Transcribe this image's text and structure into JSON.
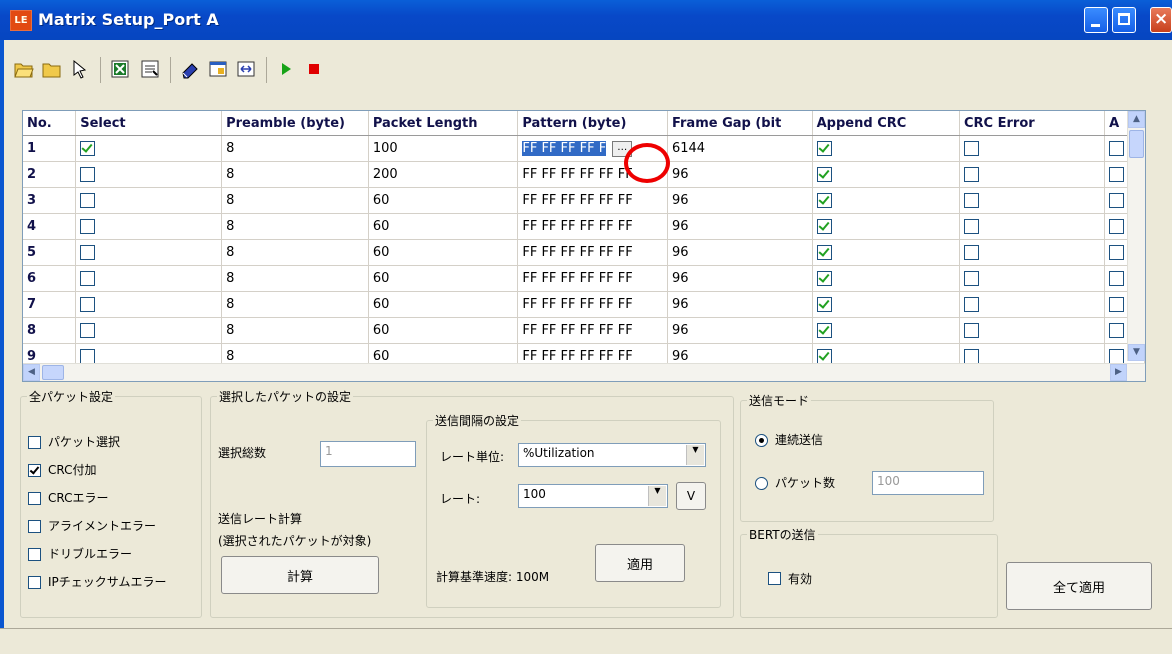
{
  "window": {
    "title": "Matrix Setup_Port A",
    "app_icon": "LE"
  },
  "toolbar": {
    "icons": [
      "open-folder-icon",
      "folder-icon",
      "pointer-icon",
      "excel-icon",
      "export-icon",
      "eraser-icon",
      "window-icon",
      "fit-width-icon",
      "play-icon",
      "stop-icon"
    ],
    "colors": {
      "play": "#17a317",
      "stop": "#e00000"
    }
  },
  "grid": {
    "columns": [
      "No.",
      "Select",
      "Preamble (byte)",
      "Packet Length",
      "Pattern (byte)",
      "Frame Gap (bit",
      "Append CRC",
      "CRC Error",
      "A"
    ],
    "rows": [
      {
        "no": "1",
        "select": true,
        "preamble": "8",
        "length": "100",
        "pattern": "FF FF FF FF F",
        "gap": "6144",
        "crc": true,
        "crc_error": false
      },
      {
        "no": "2",
        "select": false,
        "preamble": "8",
        "length": "200",
        "pattern": "FF FF FF FF FF FF",
        "gap": "96",
        "crc": true,
        "crc_error": false
      },
      {
        "no": "3",
        "select": false,
        "preamble": "8",
        "length": "60",
        "pattern": "FF FF FF FF FF FF",
        "gap": "96",
        "crc": true,
        "crc_error": false
      },
      {
        "no": "4",
        "select": false,
        "preamble": "8",
        "length": "60",
        "pattern": "FF FF FF FF FF FF",
        "gap": "96",
        "crc": true,
        "crc_error": false
      },
      {
        "no": "5",
        "select": false,
        "preamble": "8",
        "length": "60",
        "pattern": "FF FF FF FF FF FF",
        "gap": "96",
        "crc": true,
        "crc_error": false
      },
      {
        "no": "6",
        "select": false,
        "preamble": "8",
        "length": "60",
        "pattern": "FF FF FF FF FF FF",
        "gap": "96",
        "crc": true,
        "crc_error": false
      },
      {
        "no": "7",
        "select": false,
        "preamble": "8",
        "length": "60",
        "pattern": "FF FF FF FF FF FF",
        "gap": "96",
        "crc": true,
        "crc_error": false
      },
      {
        "no": "8",
        "select": false,
        "preamble": "8",
        "length": "60",
        "pattern": "FF FF FF FF FF FF",
        "gap": "96",
        "crc": true,
        "crc_error": false
      },
      {
        "no": "9",
        "select": false,
        "preamble": "8",
        "length": "60",
        "pattern": "FF FF FF FF FF FF",
        "gap": "96",
        "crc": true,
        "crc_error": false
      }
    ]
  },
  "all_packet": {
    "legend": "全パケット設定",
    "options": [
      {
        "label": "パケット選択",
        "checked": false
      },
      {
        "label": "CRC付加",
        "checked": true
      },
      {
        "label": "CRCエラー",
        "checked": false
      },
      {
        "label": "アライメントエラー",
        "checked": false
      },
      {
        "label": "ドリブルエラー",
        "checked": false
      },
      {
        "label": "IPチェックサムエラー",
        "checked": false
      }
    ]
  },
  "selected_packet": {
    "legend": "選択したパケットの設定",
    "total_label": "選択総数",
    "total_value": "1",
    "rate_calc_label": "送信レート計算",
    "rate_calc_note": "(選択されたパケットが対象)",
    "calc_button": "計算"
  },
  "interval": {
    "legend": "送信間隔の設定",
    "rate_unit_label": "レート単位:",
    "rate_unit_value": "%Utilization",
    "rate_label": "レート:",
    "rate_value": "100",
    "v_button": "V",
    "base_speed": "計算基準速度: 100M",
    "apply_button": "適用"
  },
  "send_mode": {
    "legend": "送信モード",
    "continuous": "連続送信",
    "packet_count": "パケット数",
    "packet_count_value": "100"
  },
  "bert": {
    "legend": "BERTの送信",
    "enable": "有効"
  },
  "apply_all_button": "全て適用"
}
